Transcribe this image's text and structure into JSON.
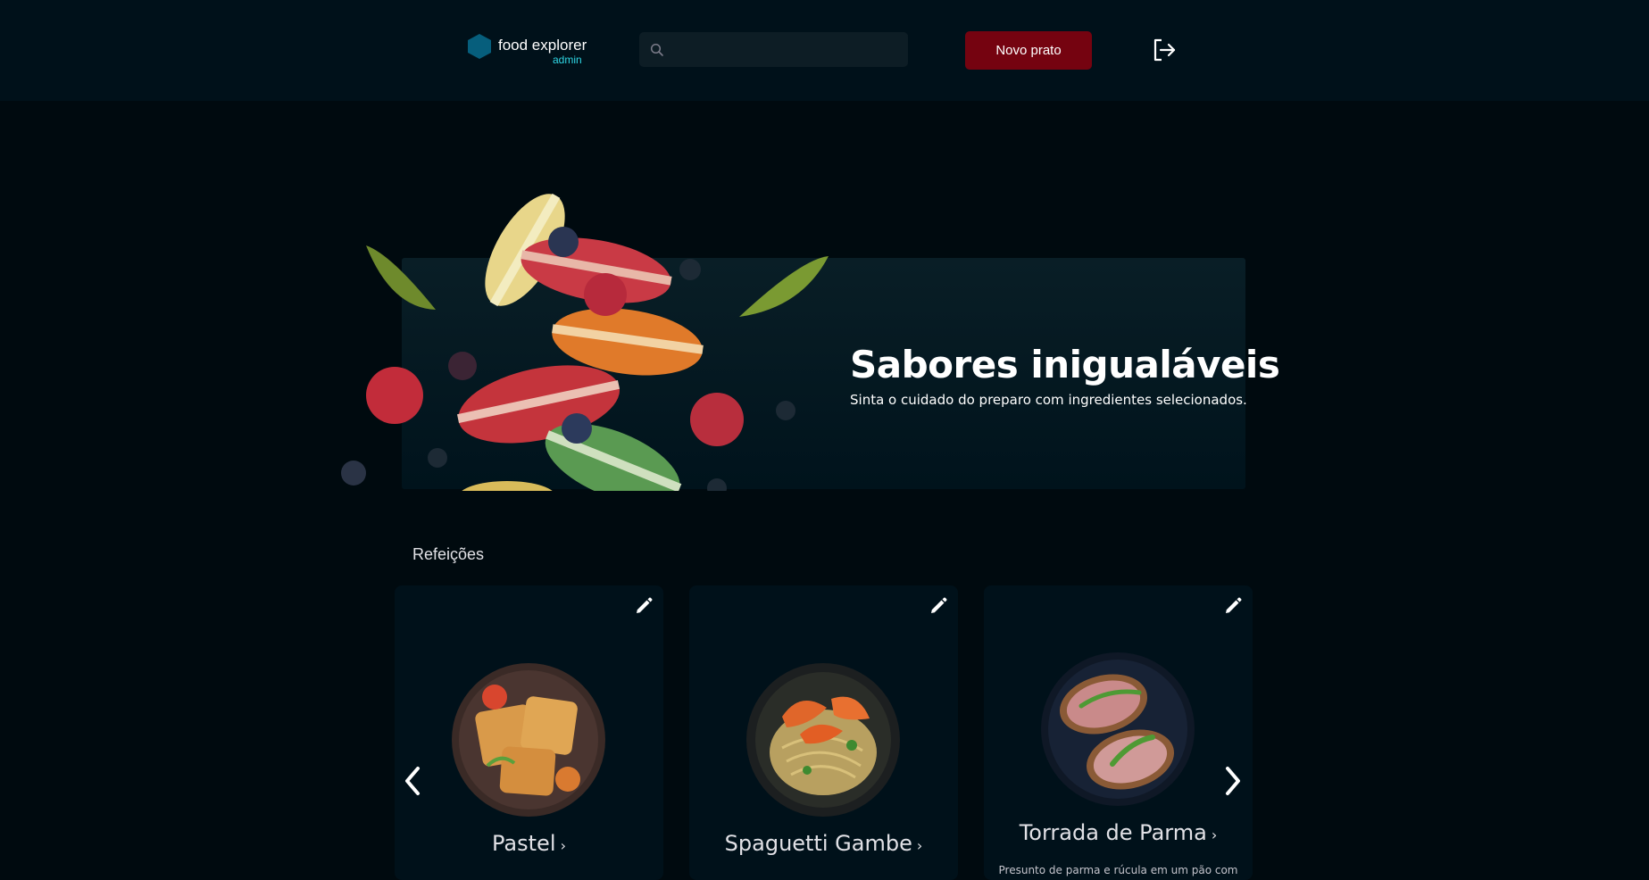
{
  "header": {
    "logo": {
      "name": "food explorer",
      "badge": "admin",
      "icon": "hexagon-logo-icon",
      "color": "#065e7c"
    },
    "search": {
      "value": "",
      "placeholder": "",
      "icon": "search-icon"
    },
    "new_dish_label": "Novo prato",
    "signout_icon": "sign-out-icon"
  },
  "hero": {
    "title": "Sabores inigualáveis",
    "subtitle": "Sinta o cuidado do preparo com ingredientes selecionados."
  },
  "section": {
    "title": "Refeições",
    "cards": [
      {
        "name": "Pastel",
        "description": "",
        "icon": "chevron-right-icon"
      },
      {
        "name": "Spaguetti Gambe",
        "description": "",
        "icon": "chevron-right-icon"
      },
      {
        "name": "Torrada de Parma",
        "description": "Presunto de parma e rúcula em um pão com",
        "icon": "chevron-right-icon"
      }
    ],
    "prev_icon": "chevron-left-icon",
    "next_icon": "chevron-right-icon"
  },
  "colors": {
    "background": "#000a0f",
    "header": "#00111a",
    "accent": "#750310",
    "badge": "#2fd8e6"
  }
}
